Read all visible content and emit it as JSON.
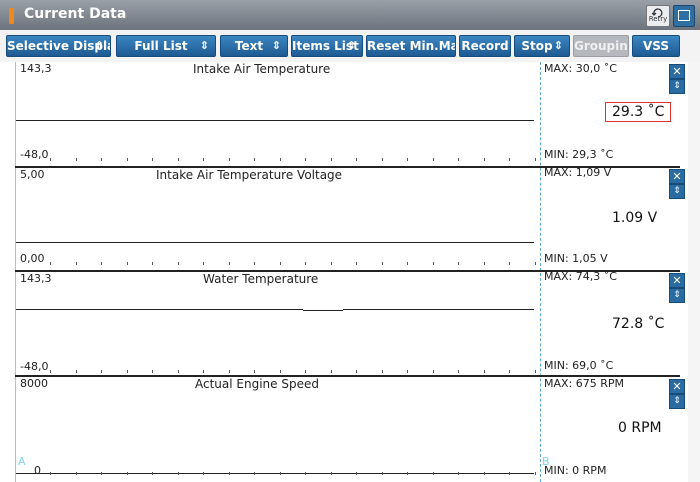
{
  "window": {
    "title": "Current Data",
    "retry_label": "Retry"
  },
  "toolbar": {
    "buttons": [
      {
        "label": "Selective Display",
        "arrows": "⇕"
      },
      {
        "label": "Full List",
        "arrows": "⇕"
      },
      {
        "label": "Text",
        "arrows": "⇕"
      },
      {
        "label": "Items List",
        "arrows": "⇕"
      },
      {
        "label": "Reset Min.Max"
      },
      {
        "label": "Record"
      },
      {
        "label": "Stop",
        "arrows": "⇕"
      },
      {
        "label": "Grouping",
        "disabled": true
      },
      {
        "label": "VSS"
      }
    ]
  },
  "panels": [
    {
      "name": "Intake Air Temperature",
      "scale_max": "143,3",
      "scale_min": "-48,0",
      "max": "MAX:  30,0 ˚C",
      "min": "MIN:  29,3 ˚C",
      "current": "29.3 ˚C",
      "highlighted": true
    },
    {
      "name": "Intake Air Temperature Voltage",
      "scale_max": "5,00",
      "scale_min": "0,00",
      "max": "MAX:  1,09 V",
      "min": "MIN:  1,05 V",
      "current": "1.09 V",
      "highlighted": false
    },
    {
      "name": "Water Temperature",
      "scale_max": "143,3",
      "scale_min": "-48,0",
      "max": "MAX:  74,3 ˚C",
      "min": "MIN:  69,0 ˚C",
      "current": "72.8 ˚C",
      "highlighted": false
    },
    {
      "name": "Actual Engine Speed",
      "scale_max": "8000",
      "scale_min": "0",
      "max": "MAX:    675 RPM",
      "min": "MIN:     0 RPM",
      "current": "0 RPM",
      "highlighted": false
    }
  ],
  "markers": {
    "a": "A",
    "b": "B"
  }
}
